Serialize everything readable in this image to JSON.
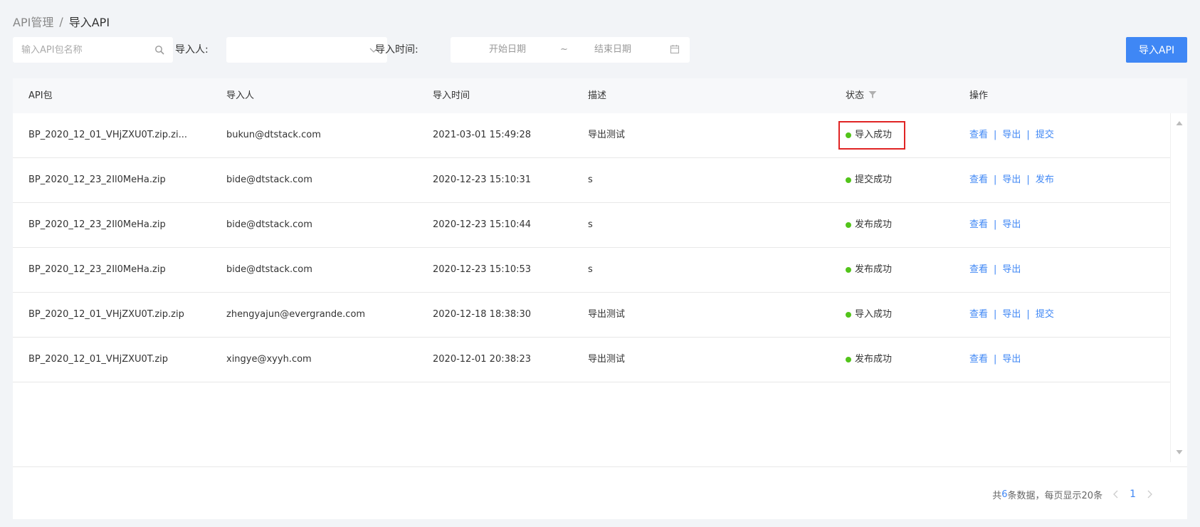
{
  "breadcrumb": {
    "parent": "API管理",
    "separator": "/",
    "current": "导入API"
  },
  "filters": {
    "search_placeholder": "输入API包名称",
    "importer_label": "导入人:",
    "importer_value": "",
    "time_label": "导入时间:",
    "start_placeholder": "开始日期",
    "range_sep": "~",
    "end_placeholder": "结束日期"
  },
  "actions": {
    "import_label": "导入API"
  },
  "table": {
    "columns": {
      "package": "API包",
      "importer": "导入人",
      "time": "导入时间",
      "desc": "描述",
      "status": "状态",
      "ops": "操作"
    },
    "rows": [
      {
        "package": "BP_2020_12_01_VHjZXU0T.zip.zi...",
        "importer": "bukun@dtstack.com",
        "time": "2021-03-01 15:49:28",
        "desc": "导出测试",
        "status": "导入成功",
        "ops": [
          "查看",
          "导出",
          "提交"
        ]
      },
      {
        "package": "BP_2020_12_23_2Il0MeHa.zip",
        "importer": "bide@dtstack.com",
        "time": "2020-12-23 15:10:31",
        "desc": "s",
        "status": "提交成功",
        "ops": [
          "查看",
          "导出",
          "发布"
        ]
      },
      {
        "package": "BP_2020_12_23_2Il0MeHa.zip",
        "importer": "bide@dtstack.com",
        "time": "2020-12-23 15:10:44",
        "desc": "s",
        "status": "发布成功",
        "ops": [
          "查看",
          "导出"
        ]
      },
      {
        "package": "BP_2020_12_23_2Il0MeHa.zip",
        "importer": "bide@dtstack.com",
        "time": "2020-12-23 15:10:53",
        "desc": "s",
        "status": "发布成功",
        "ops": [
          "查看",
          "导出"
        ]
      },
      {
        "package": "BP_2020_12_01_VHjZXU0T.zip.zip",
        "importer": "zhengyajun@evergrande.com",
        "time": "2020-12-18 18:38:30",
        "desc": "导出测试",
        "status": "导入成功",
        "ops": [
          "查看",
          "导出",
          "提交"
        ]
      },
      {
        "package": "BP_2020_12_01_VHjZXU0T.zip",
        "importer": "xingye@xyyh.com",
        "time": "2020-12-01 20:38:23",
        "desc": "导出测试",
        "status": "发布成功",
        "ops": [
          "查看",
          "导出"
        ]
      }
    ],
    "op_separator": "|",
    "highlighted_row": 0
  },
  "pagination": {
    "prefix": "共",
    "total": "6",
    "suffix": "条数据，每页显示20条",
    "current_page": "1"
  },
  "colors": {
    "primary": "#3f87f5",
    "success": "#52c41a",
    "highlight": "#e02424"
  }
}
